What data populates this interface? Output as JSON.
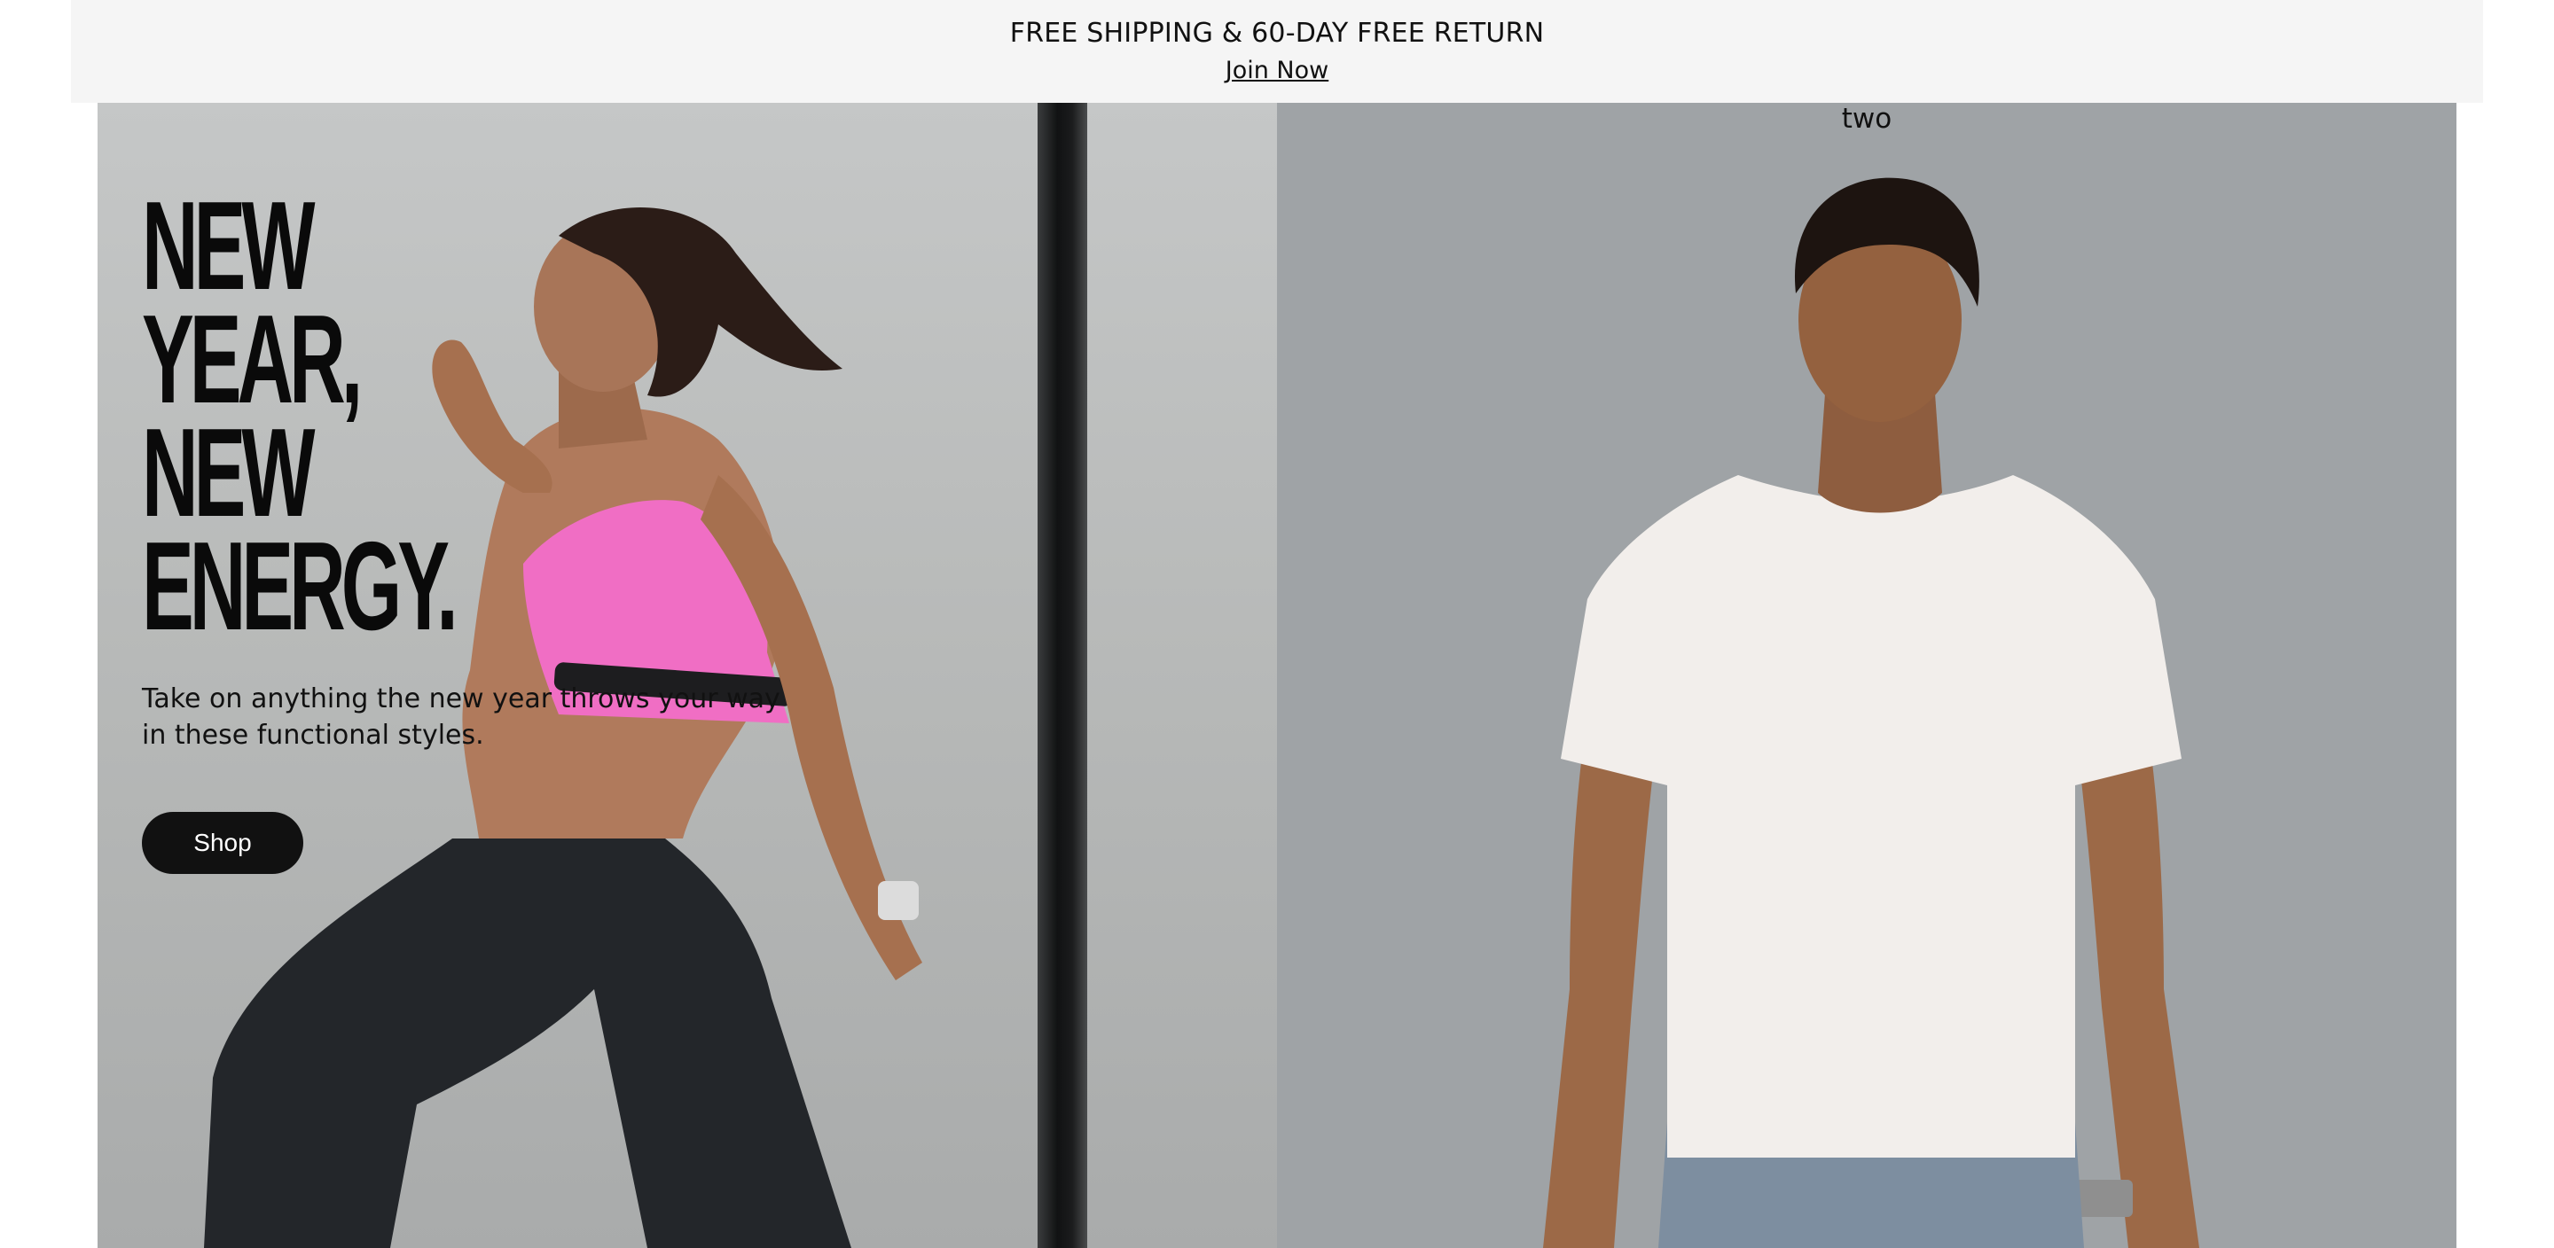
{
  "promo": {
    "text": "FREE SHIPPING & 60-DAY FREE RETURN",
    "link_label": "Join Now"
  },
  "hero_left": {
    "headline_lines": [
      "NEW",
      "YEAR,",
      "NEW",
      "ENERGY."
    ],
    "subtext": "Take on anything the new year throws your way in these functional styles.",
    "button_label": "Shop",
    "image": "woman-running-in-pink-sports-bra"
  },
  "hero_right": {
    "caption": "two",
    "image": "man-in-white-t-shirt"
  },
  "colors": {
    "promo_bg": "#f5f5f5",
    "button_bg": "#111111",
    "button_text": "#ffffff",
    "right_panel_bg": "#9fa3a6"
  }
}
